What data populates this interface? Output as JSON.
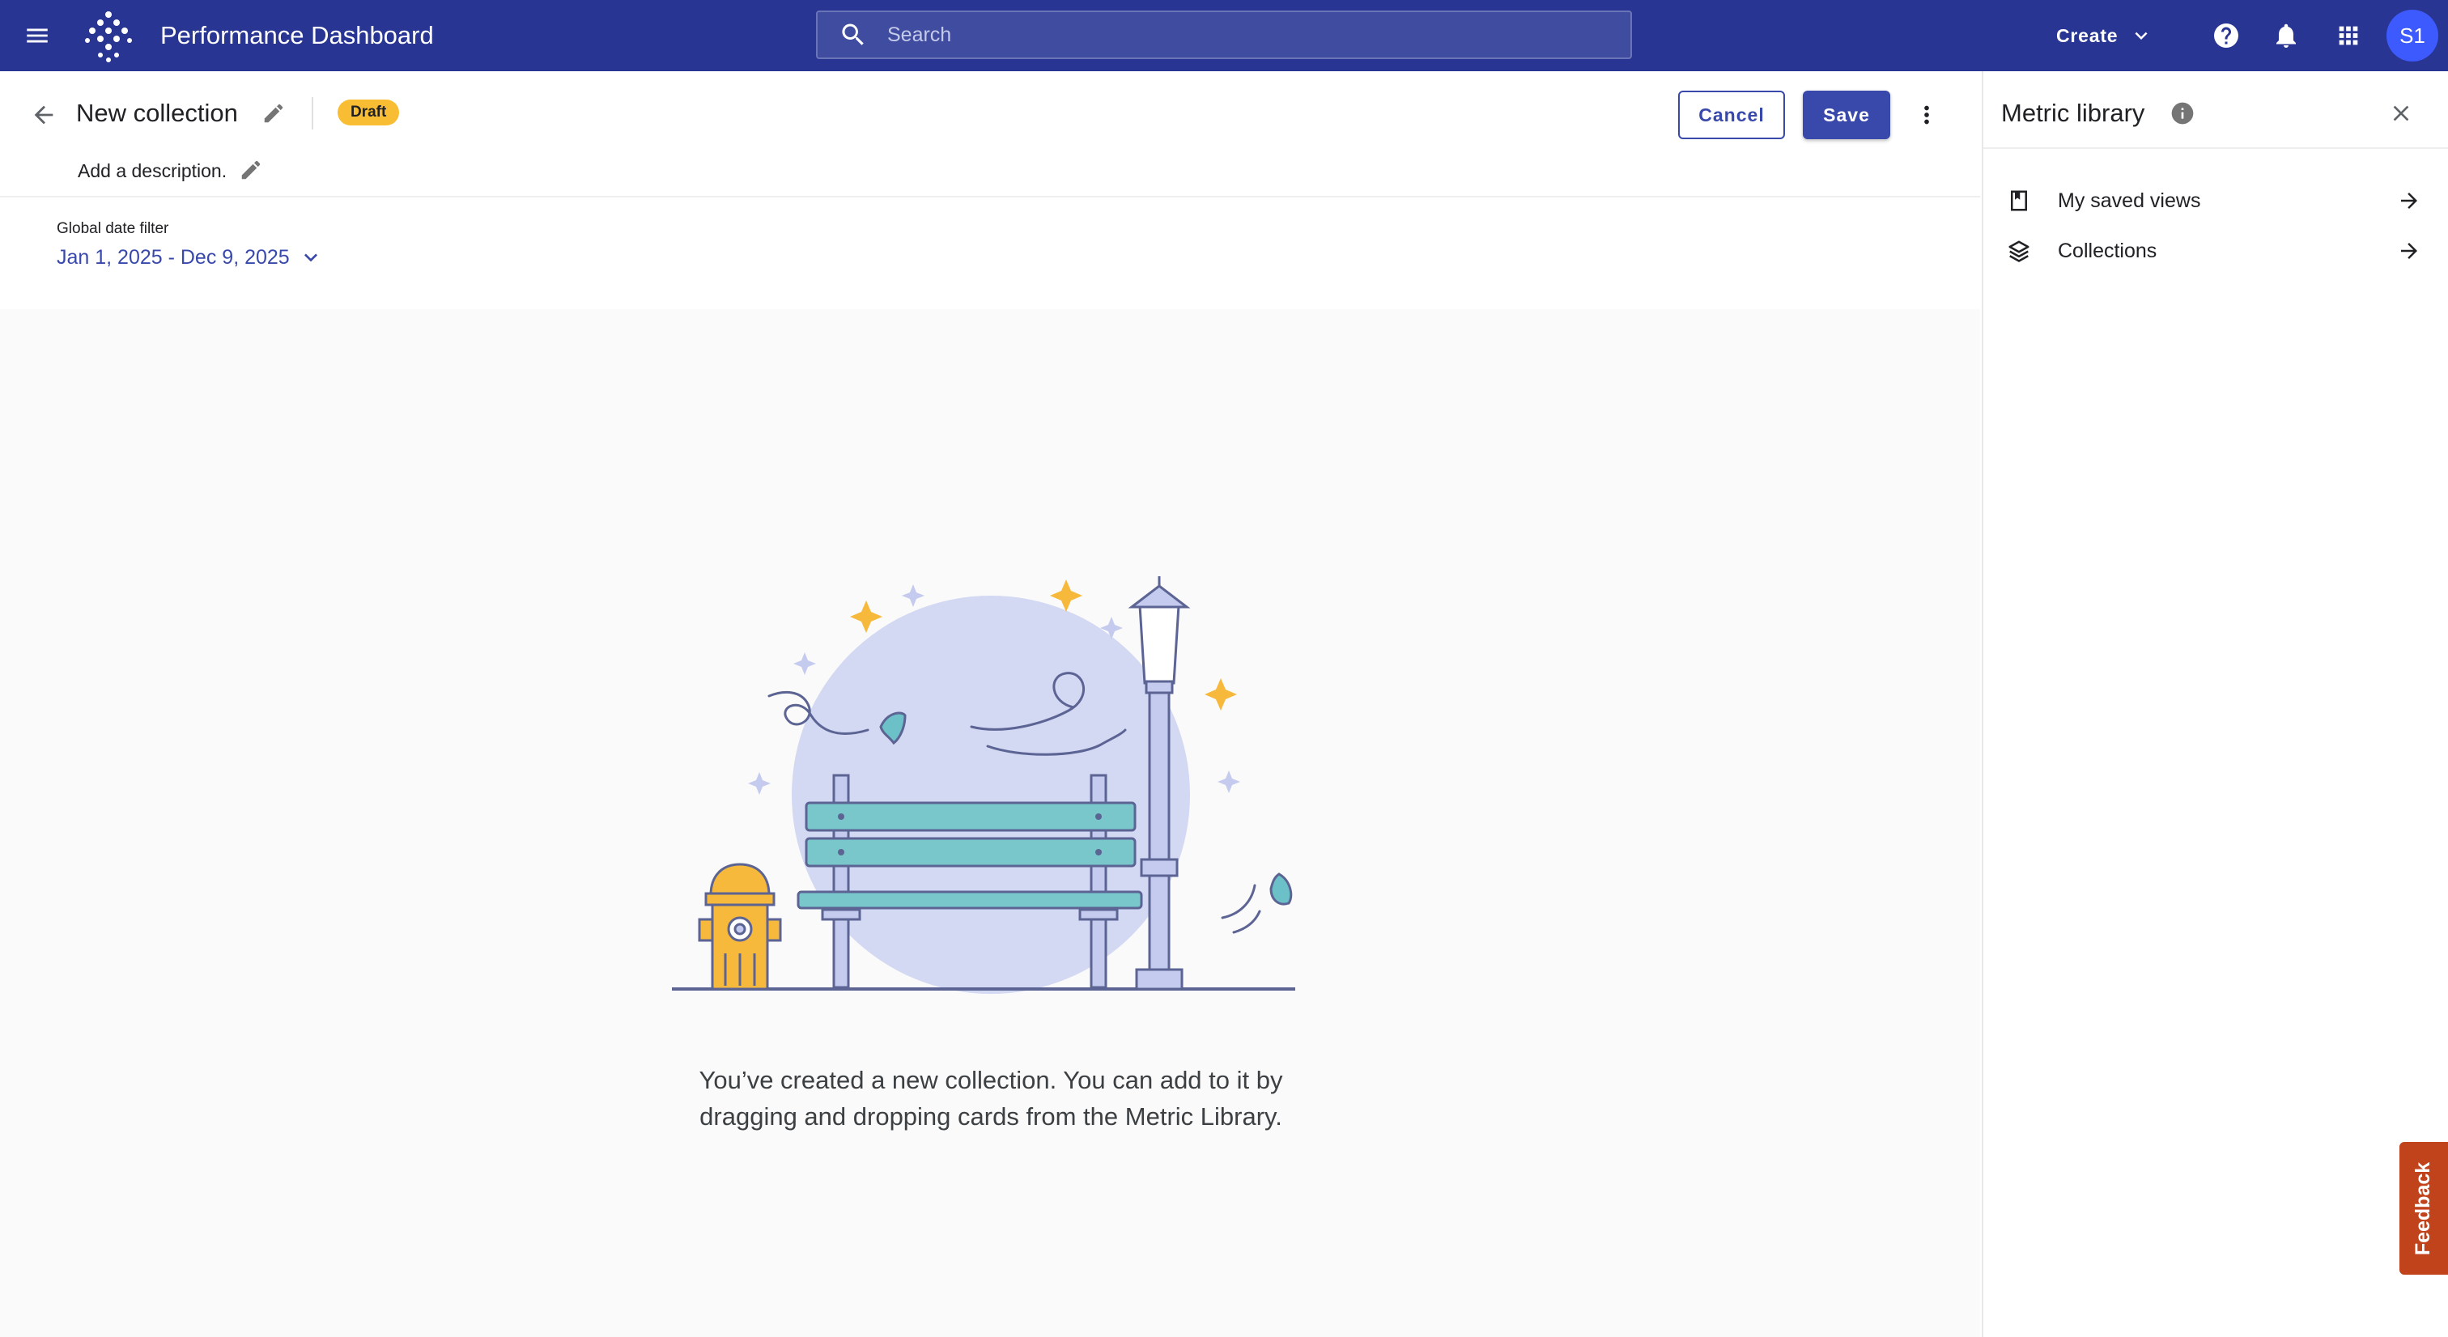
{
  "topbar": {
    "title": "Performance Dashboard",
    "search_placeholder": "Search",
    "create_label": "Create",
    "avatar_initials": "S1"
  },
  "collection": {
    "title": "New collection",
    "status_badge": "Draft",
    "description": "Add a description.",
    "cancel_label": "Cancel",
    "save_label": "Save"
  },
  "filter": {
    "label": "Global date filter",
    "value": "Jan 1, 2025 - Dec 9, 2025"
  },
  "empty_state": {
    "message": "You’ve created a new collection. You can add to it by dragging and dropping cards from the Metric Library."
  },
  "metric_library": {
    "title": "Metric library",
    "items": [
      {
        "label": "My saved views",
        "icon": "bookmark-icon"
      },
      {
        "label": "Collections",
        "icon": "layers-icon"
      }
    ]
  },
  "feedback": {
    "label": "Feedback"
  },
  "colors": {
    "topbar": "#283593",
    "accent": "#3949ab",
    "draft_badge": "#f9bd34",
    "avatar": "#3d5afe",
    "feedback": "#c0431c"
  }
}
